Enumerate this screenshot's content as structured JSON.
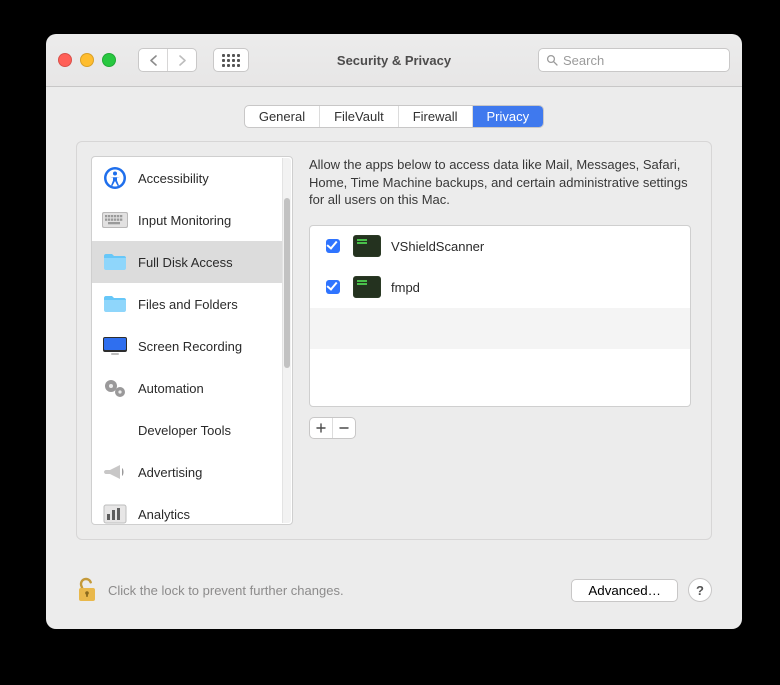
{
  "window": {
    "title": "Security & Privacy"
  },
  "search": {
    "placeholder": "Search"
  },
  "tabs": [
    {
      "label": "General"
    },
    {
      "label": "FileVault"
    },
    {
      "label": "Firewall"
    },
    {
      "label": "Privacy"
    }
  ],
  "active_tab": 3,
  "sidebar": {
    "items": [
      {
        "label": "Accessibility",
        "icon": "accessibility"
      },
      {
        "label": "Input Monitoring",
        "icon": "keyboard"
      },
      {
        "label": "Full Disk Access",
        "icon": "folder",
        "selected": true
      },
      {
        "label": "Files and Folders",
        "icon": "folder"
      },
      {
        "label": "Screen Recording",
        "icon": "display"
      },
      {
        "label": "Automation",
        "icon": "gear"
      },
      {
        "label": "Developer Tools",
        "icon": "none"
      },
      {
        "label": "Advertising",
        "icon": "megaphone"
      },
      {
        "label": "Analytics",
        "icon": "chart"
      }
    ]
  },
  "detail": {
    "description": "Allow the apps below to access data like Mail, Messages, Safari, Home, Time Machine backups, and certain administrative settings for all users on this Mac.",
    "apps": [
      {
        "name": "VShieldScanner",
        "checked": true
      },
      {
        "name": "fmpd",
        "checked": true
      }
    ]
  },
  "footer": {
    "lock_text": "Click the lock to prevent further changes.",
    "advanced_label": "Advanced…",
    "help_label": "?"
  }
}
